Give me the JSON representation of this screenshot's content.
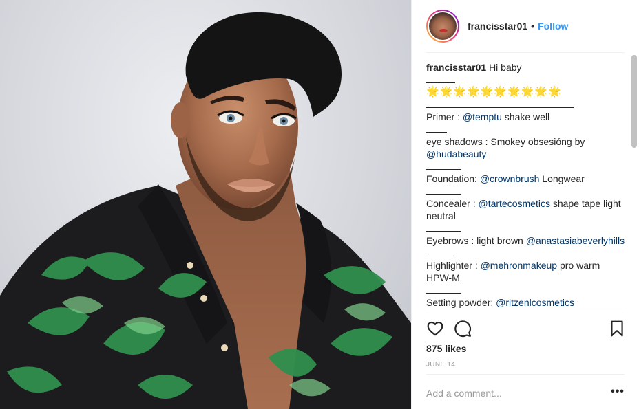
{
  "post": {
    "image_alt": "Portrait photo"
  },
  "header": {
    "username": "francisstar01",
    "dot": "•",
    "follow_label": "Follow"
  },
  "caption": {
    "username": "francisstar01",
    "text": "Hi baby",
    "sep_short": "_____",
    "stars": "🌟🌟🌟🌟🌟🌟🌟🌟🌟🌟",
    "sep_long": "—————————————-",
    "lines": [
      {
        "pre": "Primer : ",
        "mention": "@temptu",
        "post": " shake well"
      },
      {
        "pre": "eye shadows : Smokey obsesióng by ",
        "mention": "@hudabeauty",
        "post": ""
      },
      {
        "pre": "Foundation: ",
        "mention": "@crownbrush",
        "post": " Longwear"
      },
      {
        "pre": "Concealer : ",
        "mention": "@tartecosmetics",
        "post": " shape tape light neutral"
      },
      {
        "pre": "Eyebrows : light brown ",
        "mention": "@anastasiabeverlyhills",
        "post": ""
      },
      {
        "pre": "Highlighter : ",
        "mention": "@mehronmakeup",
        "post": " pro warm HPW-M"
      },
      {
        "pre": "Setting powder: ",
        "mention": "@ritzenlcosmetics",
        "post": ""
      }
    ]
  },
  "actions": {
    "like_icon": "heart-icon",
    "comment_icon": "comment-icon",
    "save_icon": "bookmark-icon"
  },
  "likes": "875 likes",
  "date": "JUNE 14",
  "comment": {
    "placeholder": "Add a comment...",
    "more_label": "•••"
  },
  "colors": {
    "follow": "#3897f0",
    "mention": "#003569",
    "text": "#262626",
    "muted": "#999999"
  }
}
